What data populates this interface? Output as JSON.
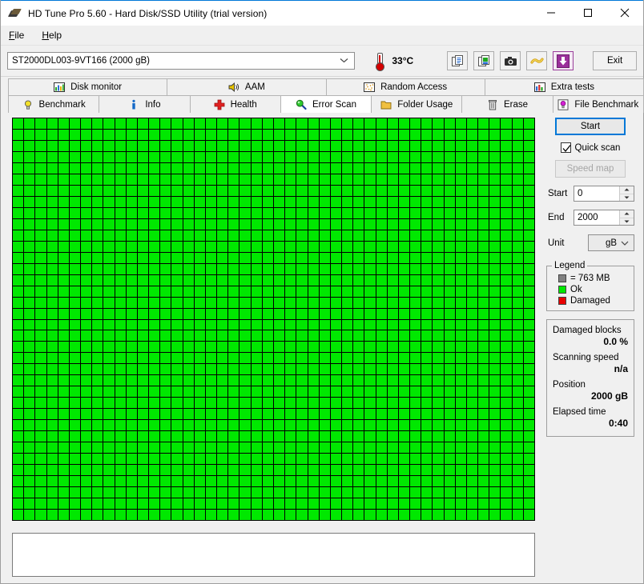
{
  "window": {
    "title": "HD Tune Pro 5.60 - Hard Disk/SSD Utility (trial version)",
    "app_icon": "disk-icon",
    "minimize_label": "–",
    "maximize_label": "□",
    "close_label": "✕"
  },
  "menu": {
    "items": [
      {
        "label": "File",
        "accel": "F"
      },
      {
        "label": "Help",
        "accel": "H"
      }
    ]
  },
  "toolbar": {
    "drive": "ST2000DL003-9VT166 (2000 gB)",
    "drive_dropdown_icon": "chevron-down-icon",
    "temperature": "33°C",
    "temperature_icon": "thermometer-icon",
    "buttons": [
      {
        "name": "copy-text-button",
        "icon": "copy-text-icon"
      },
      {
        "name": "copy-image-button",
        "icon": "copy-image-icon"
      },
      {
        "name": "screenshot-button",
        "icon": "camera-icon"
      },
      {
        "name": "purchase-button",
        "icon": "money-icon"
      },
      {
        "name": "download-button",
        "icon": "download-arrow-icon"
      }
    ],
    "exit_label": "Exit"
  },
  "tabs": {
    "top_row": [
      {
        "label": "Disk monitor",
        "icon": "bar-chart-icon",
        "active": false
      },
      {
        "label": "AAM",
        "icon": "speaker-icon",
        "active": false
      },
      {
        "label": "Random Access",
        "icon": "scatter-icon",
        "active": false
      },
      {
        "label": "Extra tests",
        "icon": "chart-icon",
        "active": false
      }
    ],
    "bottom_row": [
      {
        "label": "Benchmark",
        "icon": "lightbulb-yellow-icon",
        "active": false
      },
      {
        "label": "Info",
        "icon": "info-icon",
        "active": false
      },
      {
        "label": "Health",
        "icon": "red-cross-icon",
        "active": false
      },
      {
        "label": "Error Scan",
        "icon": "magnifier-green-icon",
        "active": true
      },
      {
        "label": "Folder Usage",
        "icon": "folder-icon",
        "active": false
      },
      {
        "label": "Erase",
        "icon": "trash-icon",
        "active": false
      },
      {
        "label": "File Benchmark",
        "icon": "lightbulb-magenta-icon",
        "active": false
      }
    ]
  },
  "scan": {
    "start_button": "Start",
    "quick_scan_label": "Quick scan",
    "quick_scan_checked": true,
    "speed_map_label": "Speed map",
    "speed_map_enabled": false,
    "start_label": "Start",
    "start_value": "0",
    "end_label": "End",
    "end_value": "2000",
    "unit_label": "Unit",
    "unit_value": "gB",
    "unit_dropdown_icon": "chevron-down-icon",
    "spinner_up_icon": "spinner-up-icon",
    "spinner_down_icon": "spinner-down-icon"
  },
  "legend": {
    "title": "Legend",
    "block_size": "= 763 MB",
    "ok_label": "Ok",
    "damaged_label": "Damaged",
    "block_color": "#808080",
    "ok_color": "#00e800",
    "damaged_color": "#e80000"
  },
  "stats": [
    {
      "key": "Damaged blocks",
      "value": "0.0 %"
    },
    {
      "key": "Scanning speed",
      "value": "n/a"
    },
    {
      "key": "Position",
      "value": "2000 gB"
    },
    {
      "key": "Elapsed time",
      "value": "0:40"
    }
  ],
  "grid": {
    "columns": 46,
    "rows": 36,
    "status": "ok",
    "cell_color": "#00e800",
    "border_color": "#000000"
  },
  "log": {
    "text": ""
  }
}
